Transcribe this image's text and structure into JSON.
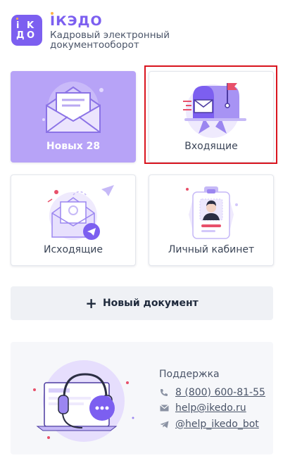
{
  "header": {
    "logo_letters": [
      "i",
      "K",
      "Э",
      "Д",
      "О"
    ],
    "brand": "IКЭДО",
    "subtitle": "Кадровый электронный документооборот"
  },
  "tiles": {
    "new": {
      "label": "Новых 28",
      "icon": "open-envelope-icon"
    },
    "incoming": {
      "label": "Входящие",
      "icon": "mailbox-icon"
    },
    "outgoing": {
      "label": "Исходящие",
      "icon": "outgoing-mail-icon"
    },
    "cabinet": {
      "label": "Личный кабинет",
      "icon": "id-badge-icon"
    }
  },
  "new_document": {
    "plus": "+",
    "label": "Новый документ"
  },
  "support": {
    "title": "Поддержка",
    "phone": "8 (800) 600-81-55",
    "email": "help@ikedo.ru",
    "telegram": "@help_ikedo_bot",
    "icons": [
      "phone-icon",
      "mail-icon",
      "telegram-icon"
    ]
  },
  "colors": {
    "brand": "#7c5ff0",
    "tile_new_bg": "#b7a3f7",
    "highlight": "#d9141e"
  }
}
